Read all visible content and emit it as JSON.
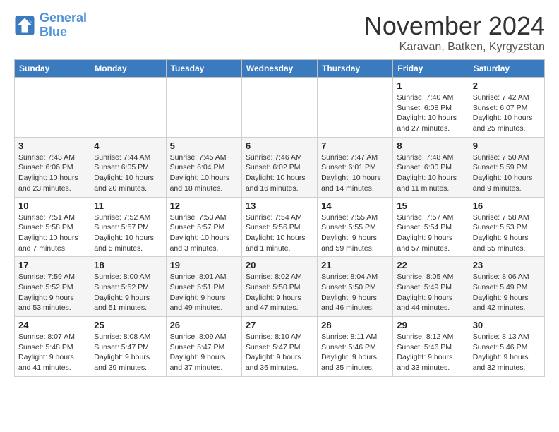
{
  "header": {
    "logo_line1": "General",
    "logo_line2": "Blue",
    "month": "November 2024",
    "location": "Karavan, Batken, Kyrgyzstan"
  },
  "weekdays": [
    "Sunday",
    "Monday",
    "Tuesday",
    "Wednesday",
    "Thursday",
    "Friday",
    "Saturday"
  ],
  "weeks": [
    [
      {
        "day": "",
        "info": ""
      },
      {
        "day": "",
        "info": ""
      },
      {
        "day": "",
        "info": ""
      },
      {
        "day": "",
        "info": ""
      },
      {
        "day": "",
        "info": ""
      },
      {
        "day": "1",
        "info": "Sunrise: 7:40 AM\nSunset: 6:08 PM\nDaylight: 10 hours and 27 minutes."
      },
      {
        "day": "2",
        "info": "Sunrise: 7:42 AM\nSunset: 6:07 PM\nDaylight: 10 hours and 25 minutes."
      }
    ],
    [
      {
        "day": "3",
        "info": "Sunrise: 7:43 AM\nSunset: 6:06 PM\nDaylight: 10 hours and 23 minutes."
      },
      {
        "day": "4",
        "info": "Sunrise: 7:44 AM\nSunset: 6:05 PM\nDaylight: 10 hours and 20 minutes."
      },
      {
        "day": "5",
        "info": "Sunrise: 7:45 AM\nSunset: 6:04 PM\nDaylight: 10 hours and 18 minutes."
      },
      {
        "day": "6",
        "info": "Sunrise: 7:46 AM\nSunset: 6:02 PM\nDaylight: 10 hours and 16 minutes."
      },
      {
        "day": "7",
        "info": "Sunrise: 7:47 AM\nSunset: 6:01 PM\nDaylight: 10 hours and 14 minutes."
      },
      {
        "day": "8",
        "info": "Sunrise: 7:48 AM\nSunset: 6:00 PM\nDaylight: 10 hours and 11 minutes."
      },
      {
        "day": "9",
        "info": "Sunrise: 7:50 AM\nSunset: 5:59 PM\nDaylight: 10 hours and 9 minutes."
      }
    ],
    [
      {
        "day": "10",
        "info": "Sunrise: 7:51 AM\nSunset: 5:58 PM\nDaylight: 10 hours and 7 minutes."
      },
      {
        "day": "11",
        "info": "Sunrise: 7:52 AM\nSunset: 5:57 PM\nDaylight: 10 hours and 5 minutes."
      },
      {
        "day": "12",
        "info": "Sunrise: 7:53 AM\nSunset: 5:57 PM\nDaylight: 10 hours and 3 minutes."
      },
      {
        "day": "13",
        "info": "Sunrise: 7:54 AM\nSunset: 5:56 PM\nDaylight: 10 hours and 1 minute."
      },
      {
        "day": "14",
        "info": "Sunrise: 7:55 AM\nSunset: 5:55 PM\nDaylight: 9 hours and 59 minutes."
      },
      {
        "day": "15",
        "info": "Sunrise: 7:57 AM\nSunset: 5:54 PM\nDaylight: 9 hours and 57 minutes."
      },
      {
        "day": "16",
        "info": "Sunrise: 7:58 AM\nSunset: 5:53 PM\nDaylight: 9 hours and 55 minutes."
      }
    ],
    [
      {
        "day": "17",
        "info": "Sunrise: 7:59 AM\nSunset: 5:52 PM\nDaylight: 9 hours and 53 minutes."
      },
      {
        "day": "18",
        "info": "Sunrise: 8:00 AM\nSunset: 5:52 PM\nDaylight: 9 hours and 51 minutes."
      },
      {
        "day": "19",
        "info": "Sunrise: 8:01 AM\nSunset: 5:51 PM\nDaylight: 9 hours and 49 minutes."
      },
      {
        "day": "20",
        "info": "Sunrise: 8:02 AM\nSunset: 5:50 PM\nDaylight: 9 hours and 47 minutes."
      },
      {
        "day": "21",
        "info": "Sunrise: 8:04 AM\nSunset: 5:50 PM\nDaylight: 9 hours and 46 minutes."
      },
      {
        "day": "22",
        "info": "Sunrise: 8:05 AM\nSunset: 5:49 PM\nDaylight: 9 hours and 44 minutes."
      },
      {
        "day": "23",
        "info": "Sunrise: 8:06 AM\nSunset: 5:49 PM\nDaylight: 9 hours and 42 minutes."
      }
    ],
    [
      {
        "day": "24",
        "info": "Sunrise: 8:07 AM\nSunset: 5:48 PM\nDaylight: 9 hours and 41 minutes."
      },
      {
        "day": "25",
        "info": "Sunrise: 8:08 AM\nSunset: 5:47 PM\nDaylight: 9 hours and 39 minutes."
      },
      {
        "day": "26",
        "info": "Sunrise: 8:09 AM\nSunset: 5:47 PM\nDaylight: 9 hours and 37 minutes."
      },
      {
        "day": "27",
        "info": "Sunrise: 8:10 AM\nSunset: 5:47 PM\nDaylight: 9 hours and 36 minutes."
      },
      {
        "day": "28",
        "info": "Sunrise: 8:11 AM\nSunset: 5:46 PM\nDaylight: 9 hours and 35 minutes."
      },
      {
        "day": "29",
        "info": "Sunrise: 8:12 AM\nSunset: 5:46 PM\nDaylight: 9 hours and 33 minutes."
      },
      {
        "day": "30",
        "info": "Sunrise: 8:13 AM\nSunset: 5:46 PM\nDaylight: 9 hours and 32 minutes."
      }
    ]
  ]
}
